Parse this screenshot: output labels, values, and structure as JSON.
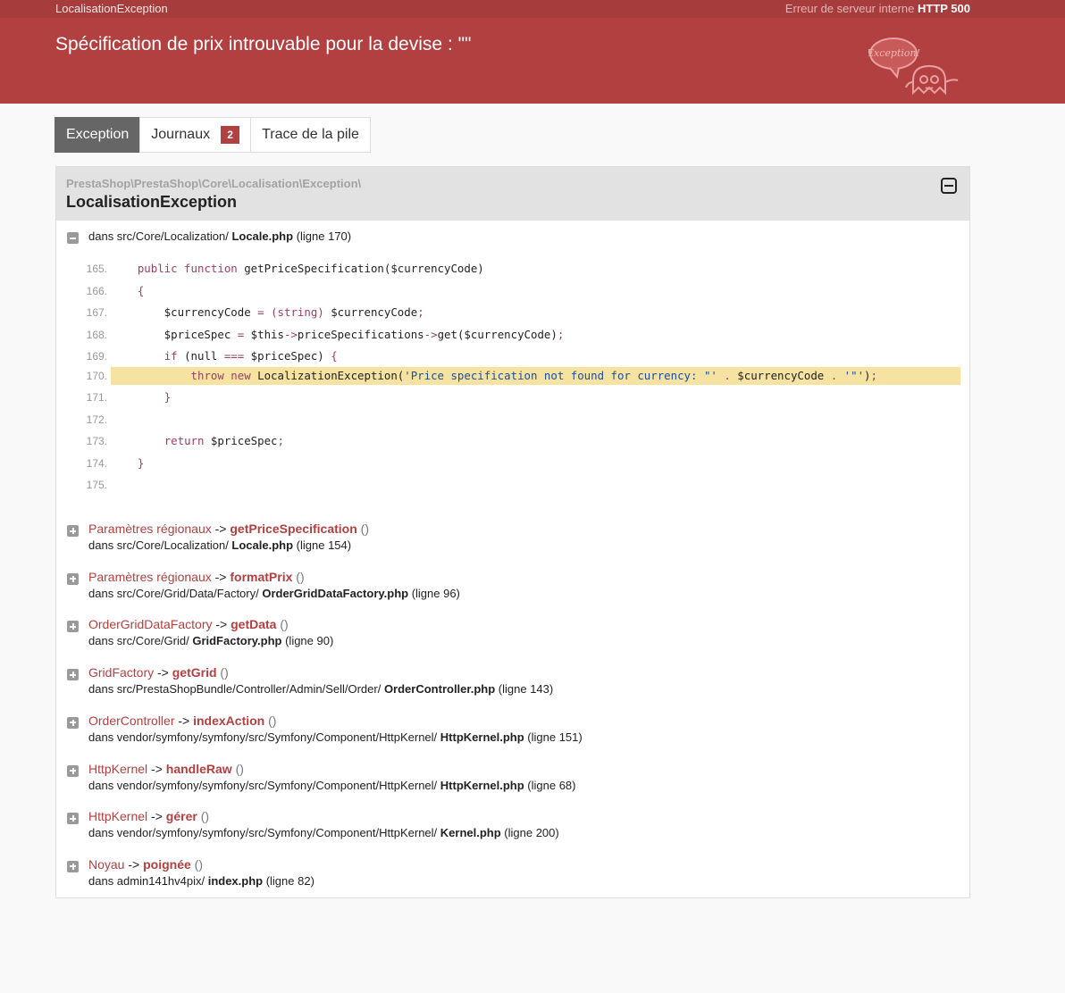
{
  "topbar": {
    "exception_class": "LocalisationException",
    "status_prefix": "Erreur de serveur interne",
    "status_code": "HTTP 500"
  },
  "header": {
    "title": "Spécification de prix introuvable pour la devise : \"\"",
    "ghost_text": "Exception!",
    "brand_color": "#b34040"
  },
  "tabs": [
    {
      "label": "Exception",
      "active": true
    },
    {
      "label": "Journaux",
      "badge": "2"
    },
    {
      "label": "Trace de la pile"
    }
  ],
  "exception": {
    "namespace": "PrestaShop\\PrestaShop\\Core\\Localisation\\Exception\\",
    "class": "LocalisationException",
    "location_prefix": "dans src/Core/Localization/",
    "location_file": "Locale.php",
    "location_line": "(ligne 170)"
  },
  "code_lines": [
    {
      "num": "165.",
      "parts": [
        [
          "",
          "    "
        ],
        [
          "kw",
          "public function"
        ],
        [
          "",
          " getPriceSpecification($currencyCode)"
        ]
      ]
    },
    {
      "num": "166.",
      "parts": [
        [
          "",
          "    "
        ],
        [
          "kw",
          "{"
        ]
      ]
    },
    {
      "num": "167.",
      "parts": [
        [
          "",
          "        $currencyCode "
        ],
        [
          "kw",
          "="
        ],
        [
          "",
          " "
        ],
        [
          "kw",
          "(string)"
        ],
        [
          "",
          " $currencyCode"
        ],
        [
          "kw",
          ";"
        ]
      ]
    },
    {
      "num": "168.",
      "parts": [
        [
          "",
          "        $priceSpec "
        ],
        [
          "kw",
          "="
        ],
        [
          "",
          " $this"
        ],
        [
          "kw",
          "->"
        ],
        [
          "",
          "priceSpecifications"
        ],
        [
          "kw",
          "->"
        ],
        [
          "",
          "get($currencyCode)"
        ],
        [
          "kw",
          ";"
        ]
      ]
    },
    {
      "num": "169.",
      "parts": [
        [
          "",
          "        "
        ],
        [
          "kw",
          "if"
        ],
        [
          "",
          " (null "
        ],
        [
          "kw",
          "==="
        ],
        [
          "",
          " $priceSpec) "
        ],
        [
          "kw",
          "{"
        ]
      ]
    },
    {
      "num": "170.",
      "highlight": true,
      "parts": [
        [
          "",
          "            "
        ],
        [
          "kw",
          "throw new"
        ],
        [
          "",
          " LocalizationException("
        ],
        [
          "str",
          "'Price specification not found for currency: \"'"
        ],
        [
          "",
          " "
        ],
        [
          "kw",
          "."
        ],
        [
          "",
          " $currencyCode "
        ],
        [
          "kw",
          "."
        ],
        [
          "",
          " "
        ],
        [
          "str",
          "'\"'"
        ],
        [
          "",
          ")"
        ],
        [
          "kw",
          ";"
        ]
      ]
    },
    {
      "num": "171.",
      "parts": [
        [
          "",
          "        "
        ],
        [
          "kw",
          "}"
        ]
      ]
    },
    {
      "num": "172.",
      "parts": [
        [
          "",
          ""
        ]
      ]
    },
    {
      "num": "173.",
      "parts": [
        [
          "",
          "        "
        ],
        [
          "kw",
          "return"
        ],
        [
          "",
          " $priceSpec"
        ],
        [
          "kw",
          ";"
        ]
      ]
    },
    {
      "num": "174.",
      "parts": [
        [
          "",
          "    "
        ],
        [
          "kw",
          "}"
        ]
      ]
    },
    {
      "num": "175.",
      "parts": [
        [
          "",
          ""
        ]
      ]
    }
  ],
  "frames": [
    {
      "cls": "Paramètres régionaux",
      "method": "getPriceSpecification",
      "args": "()",
      "dir": "dans src/Core/Localization/",
      "file": "Locale.php",
      "line": "(ligne 154)"
    },
    {
      "cls": "Paramètres régionaux",
      "method": "formatPrix",
      "args": "()",
      "dir": "dans src/Core/Grid/Data/Factory/",
      "file": "OrderGridDataFactory.php",
      "line": "(ligne 96)"
    },
    {
      "cls": "OrderGridDataFactory",
      "method": "getData",
      "args": "()",
      "dir": "dans src/Core/Grid/",
      "file": "GridFactory.php",
      "line": "(ligne 90)"
    },
    {
      "cls": "GridFactory",
      "method": "getGrid",
      "args": "()",
      "dir": "dans src/PrestaShopBundle/Controller/Admin/Sell/Order/",
      "file": "OrderController.php",
      "line": "(ligne 143)"
    },
    {
      "cls": "OrderController",
      "method": "indexAction",
      "args": "()",
      "dir": "dans vendor/symfony/symfony/src/Symfony/Component/HttpKernel/",
      "file": "HttpKernel.php",
      "line": "(ligne 151)"
    },
    {
      "cls": "HttpKernel",
      "method": "handleRaw",
      "args": "()",
      "dir": "dans vendor/symfony/symfony/src/Symfony/Component/HttpKernel/",
      "file": "HttpKernel.php",
      "line": "(ligne 68)"
    },
    {
      "cls": "HttpKernel",
      "method": "gérer",
      "args": "()",
      "dir": "dans vendor/symfony/symfony/src/Symfony/Component/HttpKernel/",
      "file": "Kernel.php",
      "line": "(ligne 200)"
    },
    {
      "cls": "Noyau",
      "method": "poignée",
      "args": "()",
      "dir": "dans admin141hv4pix/",
      "file": "index.php",
      "line": "(ligne 82)"
    }
  ],
  "arrow": "->"
}
